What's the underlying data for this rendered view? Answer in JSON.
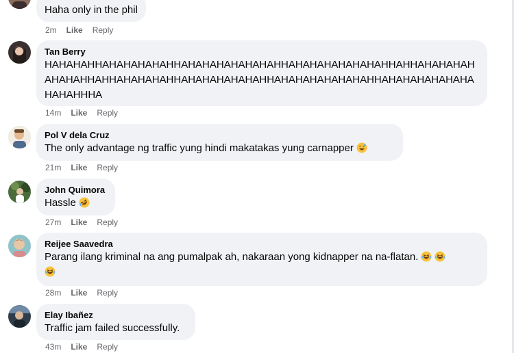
{
  "comments": [
    {
      "author": "",
      "text": "Haha only in the phil",
      "time": "2m",
      "like": "Like",
      "reply": "Reply",
      "emoji": ""
    },
    {
      "author": "Tan Berry",
      "text": "HAHAHAHHAHAHAHAHAHHAHAHAHAHAHAHAHHAHAHAHAHAHAHAHHAHHAHAHAHAHAHAHAHHAHHAHAHAHAHHAHAHAHAHAHAHHAHAHAHAHAHAHAHHAHAHAHAHAHAHAHAHAHHHA",
      "time": "14m",
      "like": "Like",
      "reply": "Reply",
      "emoji": ""
    },
    {
      "author": "Pol V dela Cruz",
      "text": "The only advantage ng traffic yung hindi makatakas yung carnapper",
      "time": "21m",
      "like": "Like",
      "reply": "Reply",
      "emoji": "grinning-sweat-emoji"
    },
    {
      "author": "John Quimora",
      "text": "Hassle",
      "time": "27m",
      "like": "Like",
      "reply": "Reply",
      "emoji": "rolling-laughing-emoji"
    },
    {
      "author": "Reijee Saavedra",
      "text": "Parang ilang kriminal na ang pumalpak ah, nakaraan yong kidnapper na na-flatan.",
      "time": "28m",
      "like": "Like",
      "reply": "Reply",
      "emoji": "laughing-emoji x3"
    },
    {
      "author": "Elay Ibañez",
      "text": "Traffic jam failed successfully.",
      "time": "43m",
      "like": "Like",
      "reply": "Reply",
      "emoji": ""
    }
  ],
  "colors": {
    "bubble": "#f0f2f5",
    "meta_text": "#65676b",
    "text": "#050505"
  }
}
